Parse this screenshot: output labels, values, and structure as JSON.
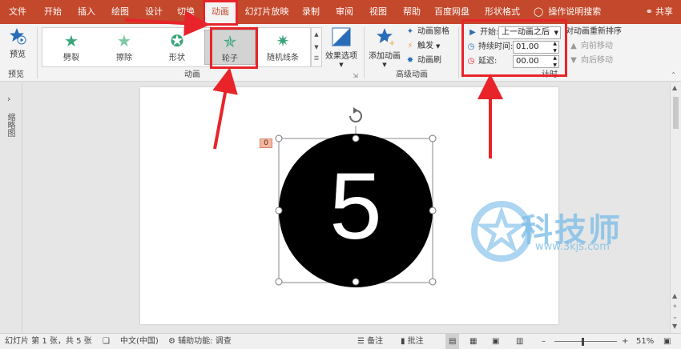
{
  "tabs": [
    "文件",
    "开始",
    "插入",
    "绘图",
    "设计",
    "切换",
    "动画",
    "幻灯片放映",
    "录制",
    "审阅",
    "视图",
    "帮助",
    "百度网盘",
    "形状格式"
  ],
  "active_tab": "动画",
  "search_label": "操作说明搜索",
  "share_label": "共享",
  "preview": {
    "label": "预览",
    "group": "预览"
  },
  "animations": [
    {
      "label": "劈裂",
      "color": "#3aa57a"
    },
    {
      "label": "擦除",
      "color": "#3aa57a"
    },
    {
      "label": "形状",
      "color": "#3aa57a"
    },
    {
      "label": "轮子",
      "color": "#3aa57a"
    },
    {
      "label": "随机线条",
      "color": "#3aa57a"
    }
  ],
  "effect_options": "效果选项",
  "animation_group": "动画",
  "advanced": {
    "add_animation": "添加动画",
    "pane": "动画窗格",
    "trigger": "触发",
    "painter": "动画刷",
    "group": "高级动画"
  },
  "timing": {
    "start_label": "开始:",
    "start_value": "上一动画之后",
    "duration_label": "持续时间:",
    "duration_value": "01.00",
    "delay_label": "延迟:",
    "delay_value": "00.00",
    "reorder": "对动画重新排序",
    "move_earlier": "向前移动",
    "move_later": "向后移动",
    "group": "计时"
  },
  "thumbnail_pane_label": "缩略图",
  "slide": {
    "number_text": "5",
    "anim_tag": "0"
  },
  "watermark": {
    "text": "科技师",
    "url": "www.3kjs.com"
  },
  "status": {
    "slide_info": "幻灯片 第 1 张，共 5 张",
    "language": "中文(中国)",
    "accessibility": "辅助功能: 调查",
    "notes": "备注",
    "comments": "批注",
    "zoom": "51%"
  },
  "colors": {
    "accent": "#c4482b",
    "highlight": "#e8242a",
    "icon_blue": "#2b6cb8",
    "star_green": "#3aa57a"
  }
}
